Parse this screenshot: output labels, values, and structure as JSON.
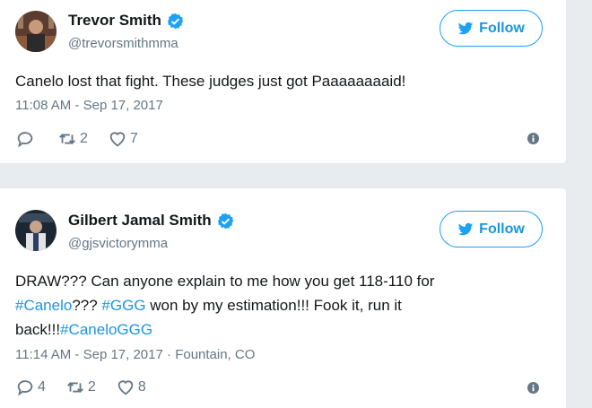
{
  "tweets": [
    {
      "author_name": "Trevor Smith",
      "handle": "@trevorsmithmma",
      "follow_label": "Follow",
      "text": "Canelo lost that fight. These judges just got Paaaaaaaaid!",
      "timestamp": "11:08 AM - Sep 17, 2017",
      "location": "",
      "replies": "",
      "retweets": "2",
      "likes": "7"
    },
    {
      "author_name": "Gilbert Jamal Smith",
      "handle": "@gjsvictorymma",
      "follow_label": "Follow",
      "text_parts": {
        "p1": "DRAW??? Can anyone explain to me how you get 118-110 for",
        "h1": "#Canelo",
        "p2": "??? ",
        "h2": "#GGG",
        "p3": " won by my estimation!!! Fook it, run it back!!!",
        "h3": "#CaneloGGG"
      },
      "timestamp": "11:14 AM - Sep 17, 2017",
      "location": "Fountain, CO",
      "replies": "4",
      "retweets": "2",
      "likes": "8"
    }
  ],
  "colors": {
    "link": "#1b95e0",
    "secondary_text": "#657786",
    "verified": "#1da1f2"
  },
  "icons": {
    "verified": "verified-badge-icon",
    "bird": "twitter-bird-icon",
    "reply": "reply-icon",
    "retweet": "retweet-icon",
    "like": "heart-icon",
    "info": "info-icon"
  }
}
